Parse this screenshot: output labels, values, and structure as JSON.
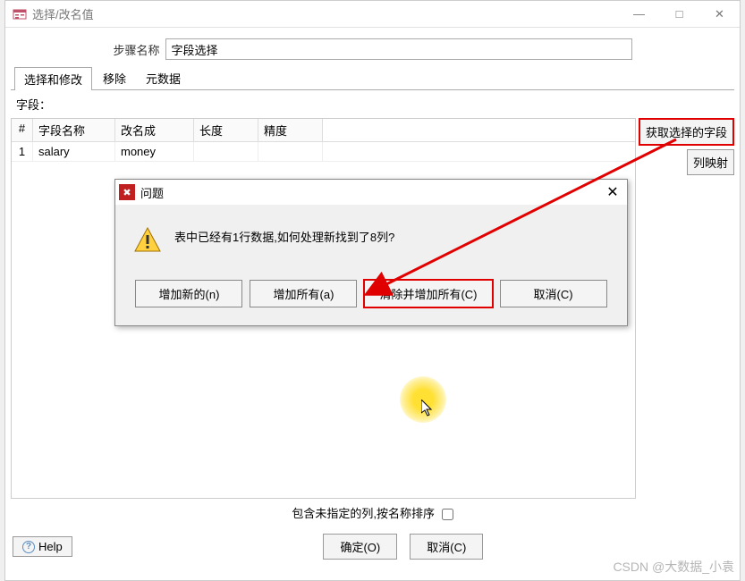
{
  "window": {
    "title": "选择/改名值",
    "controls": {
      "minimize": "—",
      "maximize": "□",
      "close": "✕"
    }
  },
  "step": {
    "label": "步骤名称",
    "value": "字段选择"
  },
  "tabs": {
    "list": [
      {
        "label": "选择和修改",
        "active": true
      },
      {
        "label": "移除",
        "active": false
      },
      {
        "label": "元数据",
        "active": false
      }
    ]
  },
  "fields": {
    "label": "字段：",
    "headers": {
      "hash": "#",
      "name": "字段名称",
      "rename": "改名成",
      "length": "长度",
      "precision": "精度"
    },
    "rows": [
      {
        "num": "1",
        "name": "salary",
        "rename": "money",
        "length": "",
        "precision": ""
      }
    ]
  },
  "side_buttons": {
    "get_fields": "获取选择的字段",
    "column_map": "列映射"
  },
  "checkbox": {
    "label": "包含未指定的列,按名称排序"
  },
  "bottom": {
    "help": "Help",
    "ok": "确定(O)",
    "cancel": "取消(C)"
  },
  "modal": {
    "title": "问题",
    "message": "表中已经有1行数据,如何处理新找到了8列?",
    "buttons": {
      "add_new": "增加新的(n)",
      "add_all": "增加所有(a)",
      "clear_add_all": "清除并增加所有(C)",
      "cancel": "取消(C)"
    }
  },
  "watermark": "CSDN @大数据_小袁"
}
